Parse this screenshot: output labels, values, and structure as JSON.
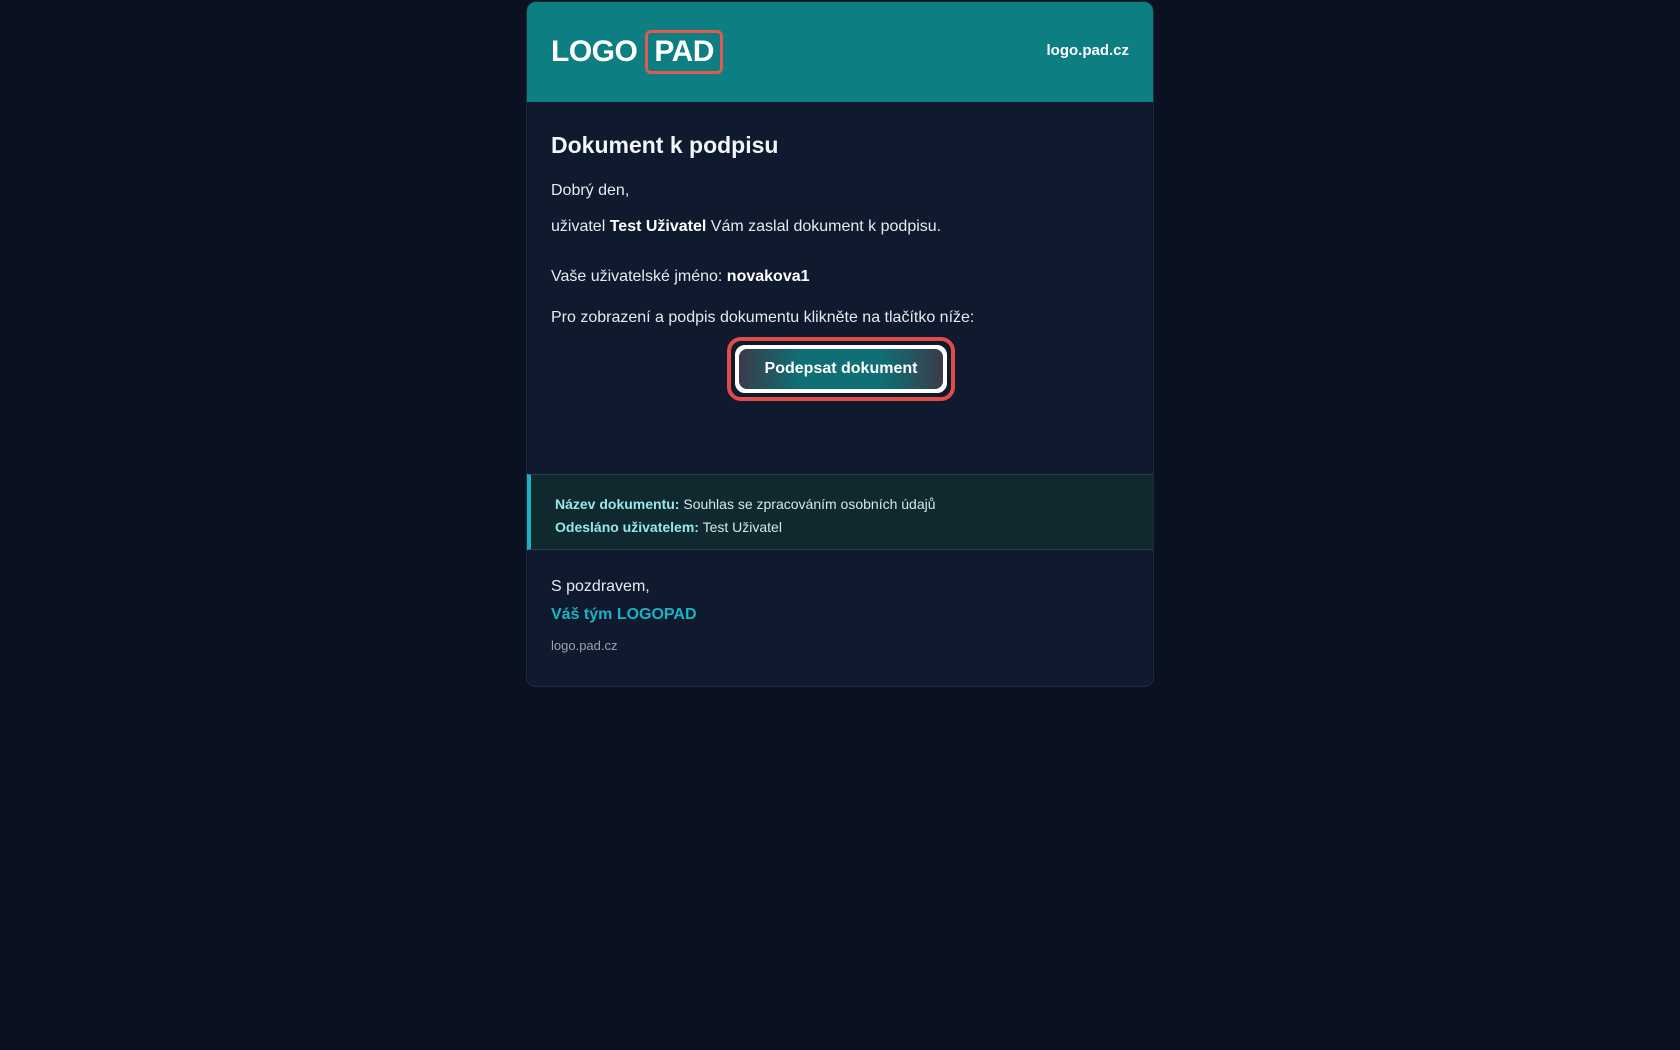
{
  "header": {
    "logo_left": "LOGO",
    "logo_right": "PAD",
    "site_link": "logo.pad.cz"
  },
  "email": {
    "title": "Dokument k podpisu",
    "greeting": "Dobrý den,",
    "sent_prefix": "uživatel ",
    "sender_name": "Test Uživatel",
    "sent_suffix": " Vám zaslal dokument k podpisu.",
    "username_label": "Vaše uživatelské jméno: ",
    "username": "novakova1",
    "instruction": "Pro zobrazení a podpis dokumentu klikněte na tlačítko níže:",
    "sign_button": "Podepsat dokument"
  },
  "info": {
    "doc_name_label": "Název dokumentu:",
    "doc_name": " Souhlas se zpracováním osobních údajů",
    "sent_by_label": "Odesláno uživatelem:",
    "sent_by": " Test Uživatel"
  },
  "footer": {
    "regards": "S pozdravem,",
    "team": "Váš tým LOGOPAD",
    "url": "logo.pad.cz"
  },
  "colors": {
    "header_bg": "#0d7f82",
    "page_bg": "#0a1120",
    "accent": "#19b3c4",
    "highlight": "#e24c46"
  }
}
